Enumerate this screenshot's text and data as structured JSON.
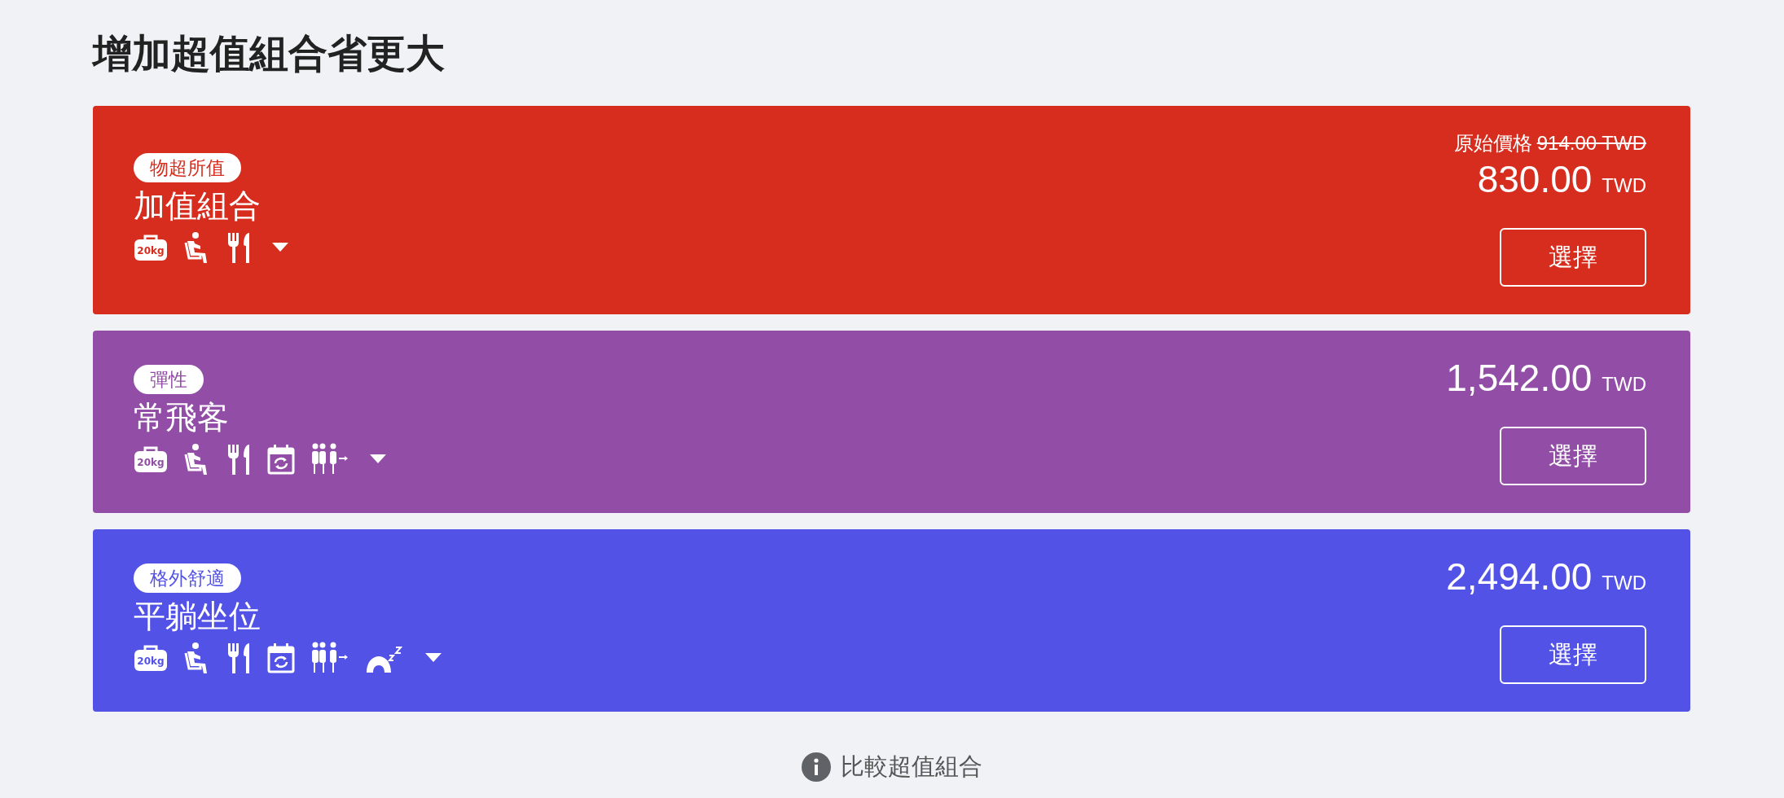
{
  "title": "增加超值組合省更大",
  "bundles": [
    {
      "badge": "物超所值",
      "name": "加值組合",
      "color": "#d62d1e",
      "original_label": "原始價格",
      "original_price": "914.00 TWD",
      "price": "830.00",
      "currency": "TWD",
      "button": "選擇",
      "features": [
        {
          "kind": "baggage",
          "text": "20kg"
        },
        {
          "kind": "seat"
        },
        {
          "kind": "meal"
        }
      ]
    },
    {
      "badge": "彈性",
      "name": "常飛客",
      "color": "#924ea6",
      "price": "1,542.00",
      "currency": "TWD",
      "button": "選擇",
      "features": [
        {
          "kind": "baggage",
          "text": "20kg"
        },
        {
          "kind": "seat"
        },
        {
          "kind": "meal"
        },
        {
          "kind": "change"
        },
        {
          "kind": "priority"
        }
      ]
    },
    {
      "badge": "格外舒適",
      "name": "平躺坐位",
      "color": "#5352e6",
      "price": "2,494.00",
      "currency": "TWD",
      "button": "選擇",
      "features": [
        {
          "kind": "baggage",
          "text": "20kg"
        },
        {
          "kind": "seat"
        },
        {
          "kind": "meal"
        },
        {
          "kind": "change"
        },
        {
          "kind": "priority"
        },
        {
          "kind": "pillow"
        }
      ]
    }
  ],
  "compare_link": "比較超值組合"
}
